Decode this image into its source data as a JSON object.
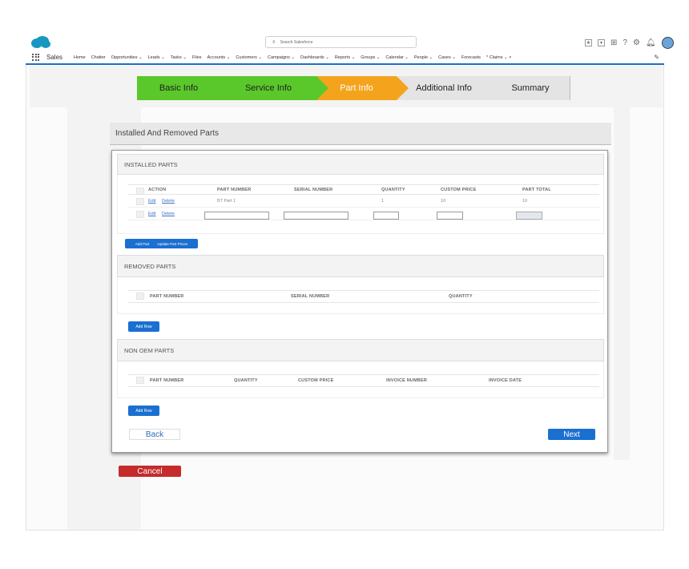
{
  "header": {
    "search_placeholder": "Search Salesforce",
    "app_name": "Sales"
  },
  "nav": {
    "items": [
      "Home",
      "Chatter",
      "Opportunities ⌄",
      "Leads ⌄",
      "Tasks ⌄",
      "Files",
      "Accounts ⌄",
      "Customers ⌄",
      "Campaigns ⌄",
      "Dashboards ⌄",
      "Reports ⌄",
      "Groups ⌄",
      "Calendar ⌄",
      "People ⌄",
      "Cases ⌄",
      "Forecasts",
      "* Claims ⌄ ×"
    ]
  },
  "steps": [
    "Basic Info",
    "Service Info",
    "Part Info",
    "Additional Info",
    "Summary"
  ],
  "section_title": "Installed And Removed Parts",
  "installed": {
    "title": "INSTALLED PARTS",
    "columns": [
      "ACTION",
      "PART NUMBER",
      "SERIAL NUMBER",
      "QUANTITY",
      "CUSTOM PRICE",
      "PART TOTAL"
    ],
    "row": {
      "edit": "Edit",
      "delete": "Delete",
      "part_number": "BT Part 1",
      "quantity": "1",
      "custom_price": "10",
      "part_total": "10"
    },
    "add_part": "Add Part",
    "update_prices": "Update Part Prices"
  },
  "removed": {
    "title": "REMOVED PARTS",
    "columns": [
      "PART NUMBER",
      "SERIAL NUMBER",
      "QUANTITY"
    ],
    "add_row": "Add Row"
  },
  "non_oem": {
    "title": "NON OEM PARTS",
    "columns": [
      "PART NUMBER",
      "QUANTITY",
      "CUSTOM PRICE",
      "INVOICE NUMBER",
      "INVOICE DATE"
    ],
    "add_row": "Add Row"
  },
  "buttons": {
    "back": "Back",
    "next": "Next",
    "cancel": "Cancel"
  },
  "colors": {
    "brand_blue": "#1b6fd0",
    "step_done": "#5ac82a",
    "step_current": "#f4a41c",
    "step_pending": "#e4e4e4",
    "cancel_red": "#c52b2b"
  }
}
